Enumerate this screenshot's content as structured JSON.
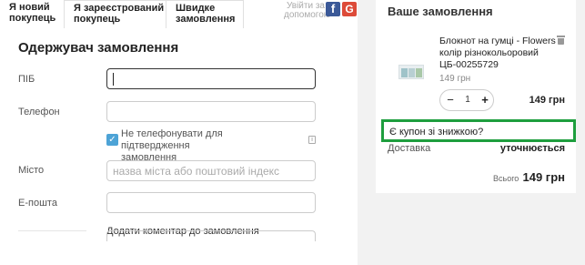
{
  "tabs": [
    {
      "line1": "Я новий",
      "line2": "покупець"
    },
    {
      "line1": "Я зареєстрований",
      "line2": "покупець"
    },
    {
      "line1": "Швидке",
      "line2": "замовлення"
    }
  ],
  "social": {
    "line1": "Увійти за",
    "line2": "допомогою",
    "facebook_glyph": "f",
    "google_glyph": "G",
    "colors": {
      "facebook": "#3b5998",
      "google": "#dd4b39"
    }
  },
  "form": {
    "title": "Одержувач замовлення",
    "fields": {
      "name": {
        "label": "ПІБ",
        "value": ""
      },
      "phone": {
        "label": "Телефон",
        "value": ""
      },
      "city": {
        "label": "Місто",
        "placeholder": "назва міста або поштовий індекс"
      },
      "email": {
        "label": "Е-пошта",
        "value": ""
      }
    },
    "no_call": {
      "line1": "Не телефонувати для підтвердження",
      "line2": "замовлення",
      "checked": true
    },
    "add_comment": "Додати коментар до замовлення"
  },
  "order": {
    "title": "Ваше замовлення",
    "item": {
      "name_line1": "Блокнот на гумці - Flowers",
      "name_line2": "колір різнокольоровий",
      "name_line3": "ЦБ-00255729",
      "unit_price": "149 грн",
      "quantity": "1",
      "line_total": "149 грн"
    },
    "coupon": "Є купон зі знижкою?",
    "shipping_label": "Доставка",
    "shipping_value": "уточнюється",
    "total_label": "Всього",
    "total_value": "149 грн",
    "highlight_color": "#1e9e3e"
  }
}
